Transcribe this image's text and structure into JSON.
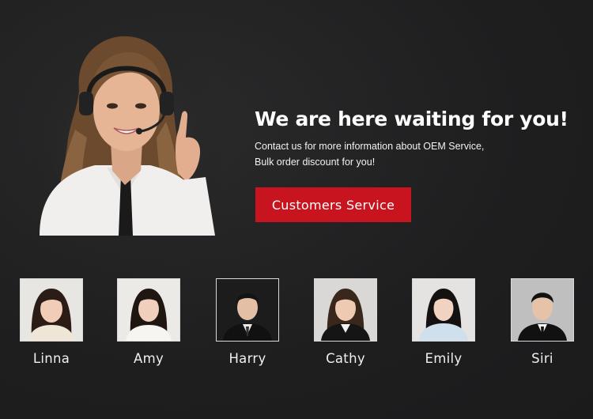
{
  "hero": {
    "title": "We are here waiting for you!",
    "subtitle_line1": "Contact us for more information about OEM Service,",
    "subtitle_line2": "Bulk order discount for you!",
    "cta_label": "Customers Service",
    "image": "customer-service-agent-with-headset"
  },
  "team": [
    {
      "name": "Linna",
      "photo": "portrait-woman-long-hair-white-top"
    },
    {
      "name": "Amy",
      "photo": "portrait-woman-white-blouse"
    },
    {
      "name": "Harry",
      "photo": "portrait-man-black-suit"
    },
    {
      "name": "Cathy",
      "photo": "portrait-woman-black-blazer"
    },
    {
      "name": "Emily",
      "photo": "portrait-woman-light-blue-top"
    },
    {
      "name": "Siri",
      "photo": "portrait-man-black-suit-tie"
    }
  ],
  "colors": {
    "background": "#1f1f20",
    "accent": "#c8141e",
    "text": "#ffffff"
  }
}
